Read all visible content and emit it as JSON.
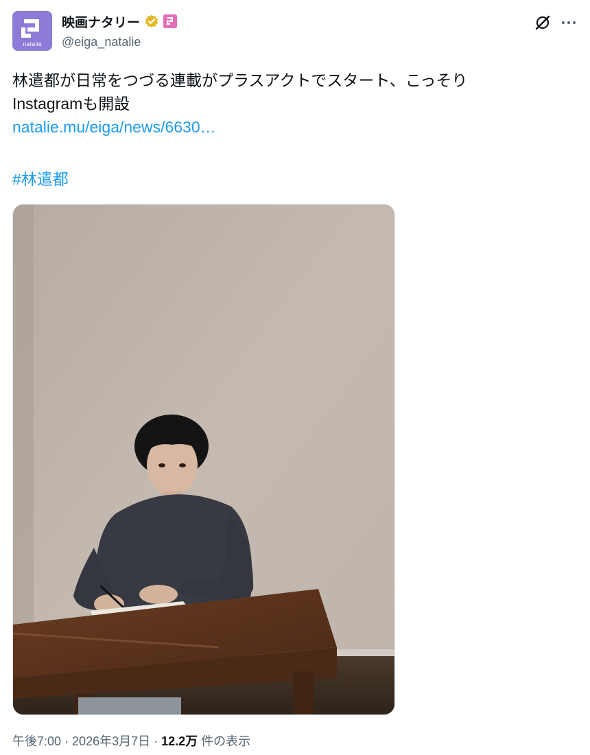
{
  "author": {
    "display_name": "映画ナタリー",
    "handle": "@eiga_natalie",
    "avatar_text": "natalie",
    "avatar_color": "#8e7bd8",
    "verified_badge_color": "#e8b829",
    "affiliate_badge_color": "#e56fb8"
  },
  "tweet": {
    "text_line1": "林遣都が日常をつづる連載がプラスアクトでスタート、こっそり",
    "text_line2": "Instagramも開設",
    "link": "natalie.mu/eiga/news/6630…",
    "hashtag": "#林遣都"
  },
  "meta": {
    "time": "午後7:00",
    "separator1": " · ",
    "date": "2026年3月7日",
    "separator2": " · ",
    "views_count": "12.2万",
    "views_label": " 件の表示"
  },
  "icons": {
    "grok": "grok-icon",
    "more": "more-options-icon",
    "verified": "verified-badge-icon",
    "affiliate": "affiliate-badge-icon"
  },
  "colors": {
    "link": "#1d9bf0",
    "secondary_text": "#536471",
    "primary_text": "#0f1419"
  }
}
